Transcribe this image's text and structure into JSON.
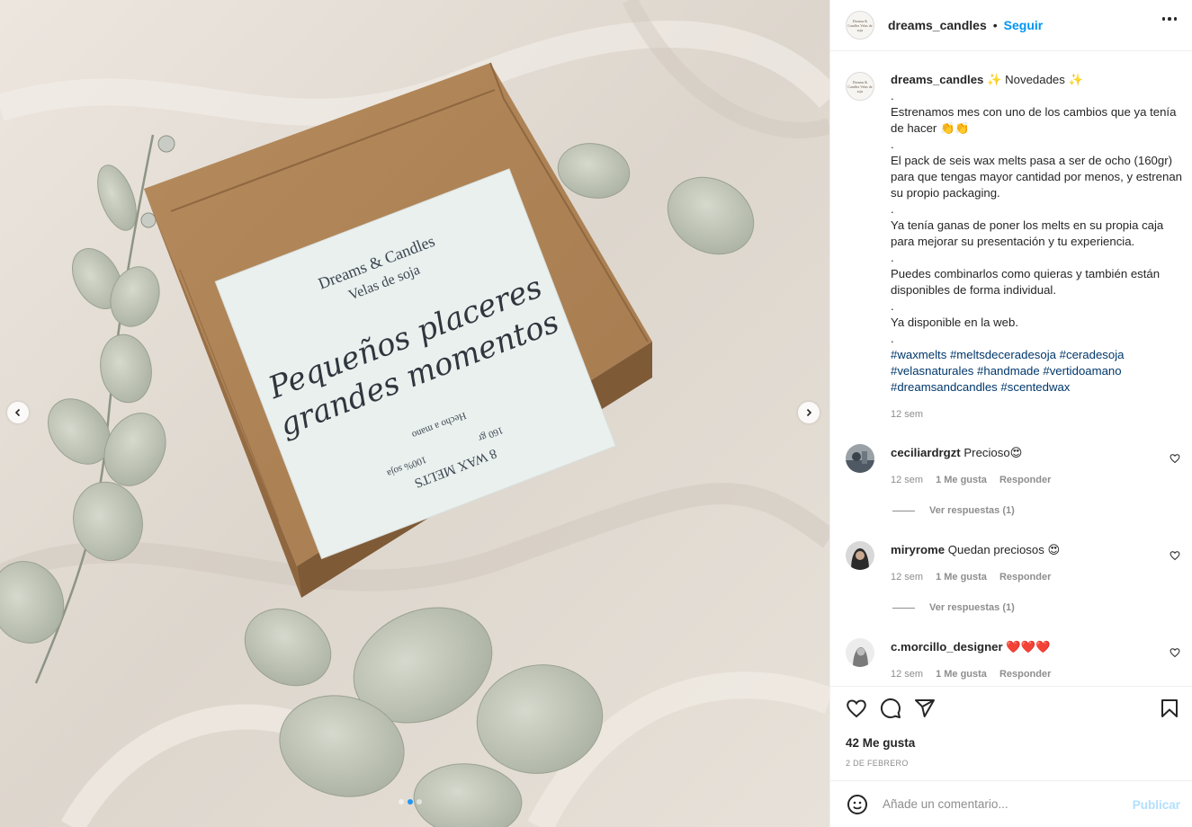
{
  "post": {
    "username": "dreams_candles",
    "follow_label": "Seguir",
    "separator": "•",
    "avatar_logo": "Dreams & Candles Velas de soja"
  },
  "image": {
    "label_brand": "Dreams & Candles",
    "label_sub": "Velas de soja",
    "label_script_1": "Pequeños placeres",
    "label_script_2": "grandes momentos",
    "label_product": "8 WAX MELTS",
    "label_weight": "160 gr",
    "label_soy": "100% soja",
    "label_handmade": "Hecho a mano",
    "carousel_count": 3,
    "carousel_active": 1
  },
  "caption": {
    "username": "dreams_candles",
    "title": "✨ Novedades ✨",
    "lines": [
      ".",
      "Estrenamos mes con uno de los cambios que ya tenía de hacer 👏👏",
      ".",
      "El pack de seis wax melts pasa a ser de ocho (160gr) para que tengas mayor cantidad por menos, y estrenan su propio packaging.",
      ".",
      "Ya tenía ganas de poner los melts en su propia caja para mejorar su presentación y tu experiencia.",
      ".",
      "Puedes combinarlos como quieras y también están disponibles de forma individual.",
      ".",
      "Ya disponible en la web.",
      "."
    ],
    "hashtags": "#waxmelts #meltsdeceradesoja #ceradesoja #velasnaturales #handmade #vertidoamano #dreamsandcandles #scentedwax",
    "time": "12 sem"
  },
  "comments": [
    {
      "username": "ceciliardrgzt",
      "text": "Precioso😍",
      "time": "12 sem",
      "likes": "1 Me gusta",
      "reply": "Responder",
      "replies": "Ver respuestas (1)"
    },
    {
      "username": "miryrome",
      "text": "Quedan preciosos 😍",
      "time": "12 sem",
      "likes": "1 Me gusta",
      "reply": "Responder",
      "replies": "Ver respuestas (1)"
    },
    {
      "username": "c.morcillo_designer",
      "text": "❤️❤️❤️",
      "time": "12 sem",
      "likes": "1 Me gusta",
      "reply": "Responder",
      "replies": ""
    }
  ],
  "footer": {
    "likes": "42 Me gusta",
    "date": "2 DE FEBRERO",
    "comment_placeholder": "Añade un comentario...",
    "post_label": "Publicar"
  },
  "colors": {
    "accent": "#0095f6",
    "hashtag": "#00376b",
    "muted": "#8e8e8e",
    "post_disabled": "#b2dffc"
  }
}
